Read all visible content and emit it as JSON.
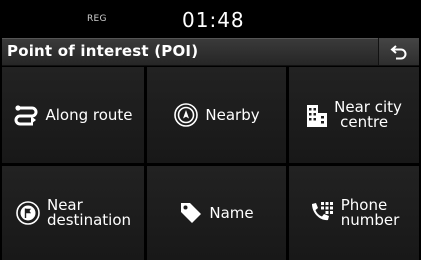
{
  "status": {
    "region": "REG",
    "time": "01:48"
  },
  "header": {
    "title": "Point of interest (POI)",
    "back_icon": "back-arrow-icon"
  },
  "tiles": [
    {
      "label": "Along route",
      "icon": "route-icon"
    },
    {
      "label": "Nearby",
      "icon": "compass-icon"
    },
    {
      "label_line1": "Near city",
      "label_line2": "centre",
      "icon": "buildings-icon"
    },
    {
      "label_line1": "Near",
      "label_line2": "destination",
      "icon": "flag-target-icon"
    },
    {
      "label": "Name",
      "icon": "tag-icon"
    },
    {
      "label_line1": "Phone",
      "label_line2": "number",
      "icon": "phone-keypad-icon"
    }
  ]
}
